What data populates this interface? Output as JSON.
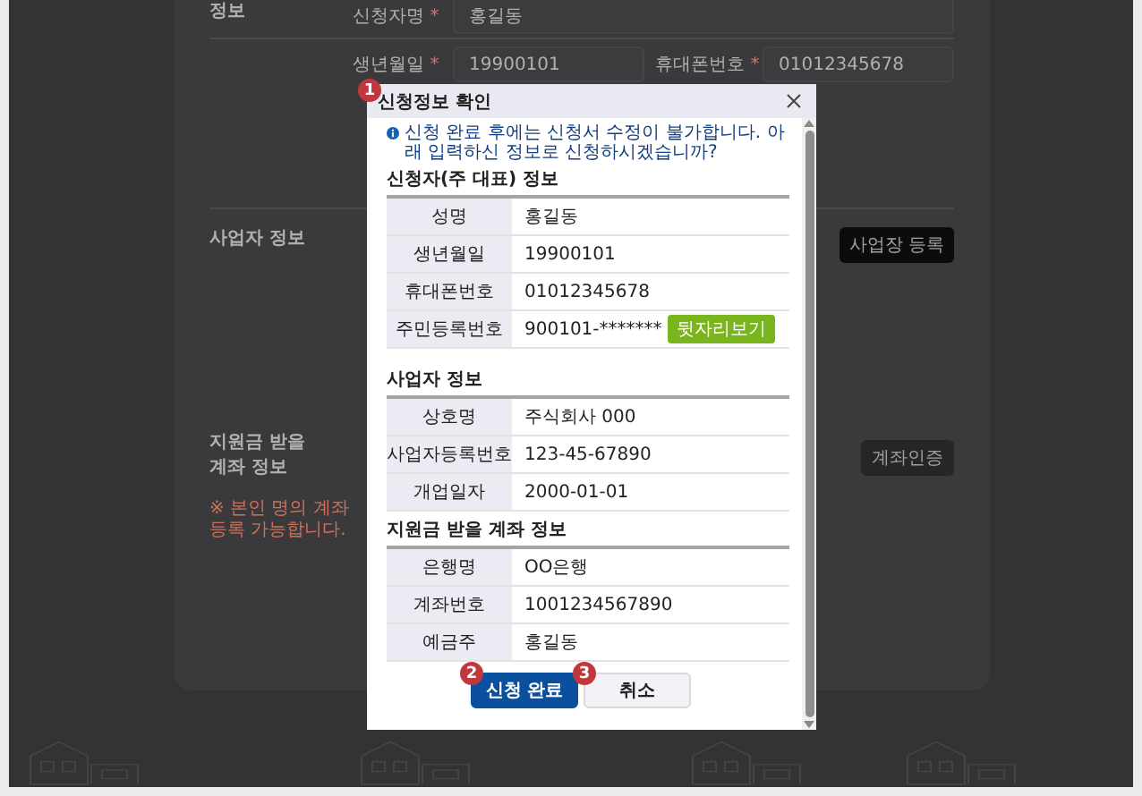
{
  "page": {
    "applicant": {
      "label": "정보",
      "fields": [
        {
          "label": "신청자명",
          "mark": "*",
          "value": "홍길동"
        },
        {
          "label": "생년월일",
          "mark": "*",
          "value": "19900101"
        },
        {
          "label": "휴대폰번호",
          "mark": "*",
          "value": "01012345678"
        }
      ]
    },
    "business": {
      "label": "사업자 정보",
      "button": "사업장 등록"
    },
    "account": {
      "label_lines": [
        "지원금 받을",
        "계좌 정보"
      ],
      "note_lines": [
        "※ 본인 명의 계좌",
        "등록 가능합니다."
      ],
      "button": "계좌인증"
    }
  },
  "dialog": {
    "title": "신청정보 확인",
    "step_badge": "1",
    "notice": "신청 완료 후에는 신청서 수정이 불가합니다. 아래 입력하신 정보로 신청하시겠습니까?",
    "sections": [
      {
        "title": "신청자(주 대표) 정보",
        "rows": [
          {
            "label": "성명",
            "value": "홍길동"
          },
          {
            "label": "생년월일",
            "value": "19900101"
          },
          {
            "label": "휴대폰번호",
            "value": "01012345678"
          },
          {
            "label": "주민등록번호",
            "value": "900101-*******",
            "button": "뒷자리보기"
          }
        ]
      },
      {
        "title": "사업자 정보",
        "rows": [
          {
            "label": "상호명",
            "value": "주식회사 000"
          },
          {
            "label": "사업자등록번호",
            "value": "123-45-67890"
          },
          {
            "label": "개업일자",
            "value": "2000-01-01"
          }
        ]
      },
      {
        "title": "지원금 받을 계좌 정보",
        "rows": [
          {
            "label": "은행명",
            "value": "OO은행"
          },
          {
            "label": "계좌번호",
            "value": "1001234567890"
          },
          {
            "label": "예금주",
            "value": "홍길동"
          }
        ]
      }
    ],
    "buttons": [
      {
        "label": "신청 완료",
        "kind": "primary",
        "badge": "2"
      },
      {
        "label": "취소",
        "kind": "secondary",
        "badge": "3"
      }
    ]
  }
}
